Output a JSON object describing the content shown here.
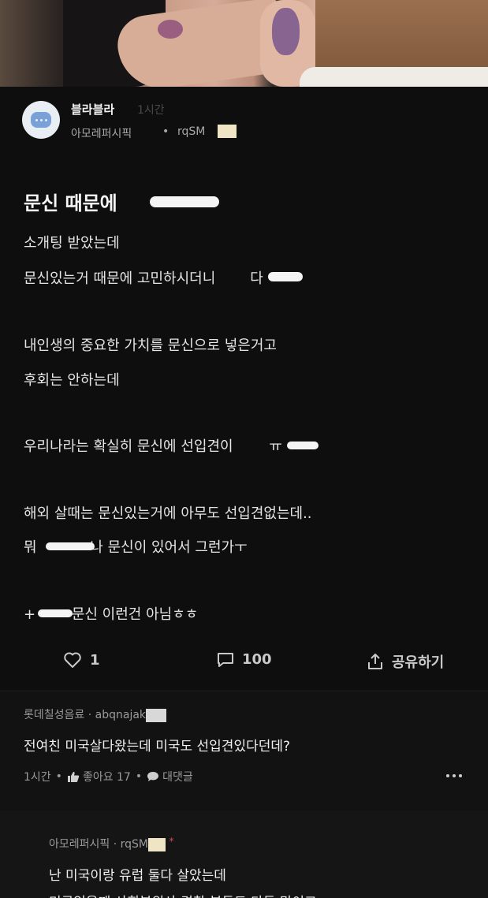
{
  "post": {
    "author": {
      "name": "블라블라",
      "time": "1시간",
      "company": "아모레퍼시픽",
      "dot": "•",
      "id": "rqSM"
    },
    "title": "문신 때문에",
    "body": [
      "소개팅 받았는데",
      "문신있는거 때문에 고민하시더니",
      "",
      "내인생의 중요한 가치를 문신으로 넣은거고",
      "후회는 안하는데",
      "",
      "우리나라는 확실히 문신에 선입견이",
      "",
      "해외 살때는 문신있는거에 아무도 선입견없는데..",
      "뭐",
      "",
      "+"
    ],
    "body_tails": {
      "line2_tail": "다",
      "line7_tail": "ㅠ",
      "line10_tail": "나 문신이 있어서 그런가ㅜ",
      "line12_tail": "문신 이런건 아님ㅎㅎ"
    },
    "actions": {
      "like_count": "1",
      "comment_count": "100",
      "share_label": "공유하기",
      "like_icon": "heart-icon",
      "comment_icon": "comment-icon",
      "share_icon": "share-icon"
    }
  },
  "comment": {
    "company": "롯데칠성음료",
    "dot": "·",
    "id": "abqnajak",
    "text": "전여친 미국살다왔는데 미국도 선입견있다던데?",
    "time": "1시간",
    "like_label": "좋아요 17",
    "reply_label": "대댓글",
    "like_icon": "thumbs-up-icon",
    "reply_icon": "speech-bubble-icon",
    "more_icon": "more-dots-icon"
  },
  "reply": {
    "company": "아모레퍼시픽",
    "dot": "·",
    "id": "rqSM",
    "author_mark": "*",
    "text": "난 미국이랑 유럽 둘다 살았는데",
    "text2": "미국있을때 사회분위사 경찰 분들도 다들 많이고"
  },
  "colors": {
    "background": "#0e0e0e",
    "text": "#e6e6e6",
    "muted": "#9a9a9a",
    "mask": "#efe4c4"
  }
}
